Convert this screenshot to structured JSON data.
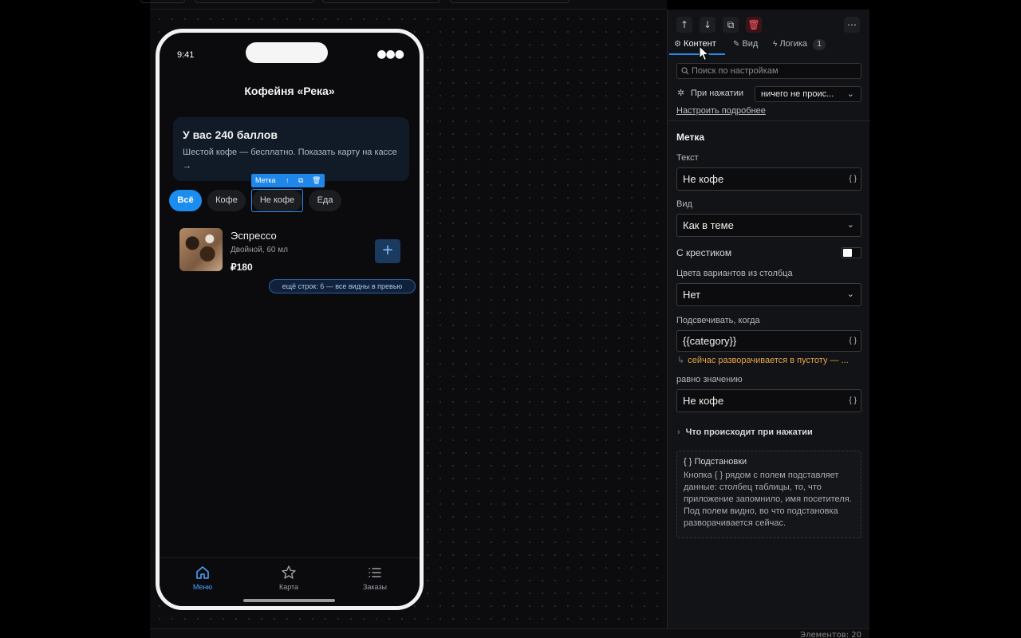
{
  "phone": {
    "time": "9:41",
    "signal": "●●●",
    "title": "Кофейня «Река»",
    "loyalty": {
      "title": "У вас 240 баллов",
      "subtitle": "Шестой кофе — бесплатно. Показать карту на кассе →"
    },
    "chips": [
      "Всё",
      "Кофе",
      "Не кофе",
      "Еда"
    ],
    "selection_tag": "Метка",
    "item": {
      "name": "Эспрессо",
      "desc": "Двойной, 60 мл",
      "price": "₽180",
      "add": "+"
    },
    "more_rows": "ещё строк: 6 — все видны в превью",
    "tabs": [
      {
        "label": "Меню",
        "icon": "home-icon"
      },
      {
        "label": "Карта",
        "icon": "star-icon"
      },
      {
        "label": "Заказы",
        "icon": "list-icon"
      }
    ]
  },
  "panel": {
    "toolbar": {
      "move_up": "↑",
      "move_down": "↓",
      "duplicate": "⧉",
      "delete": "🗑",
      "more": "⋯"
    },
    "tabs": {
      "content": "Контент",
      "view": "Вид",
      "logic": "Логика",
      "logic_badge": "1"
    },
    "search_placeholder": "Поиск по настройкам",
    "on_press_label": "При нажатии",
    "on_press_value": "ничего не проис...",
    "configure_link": "Настроить подробнее",
    "section_title": "Метка",
    "text_label": "Текст",
    "text_value": "Не кофе",
    "view_label": "Вид",
    "view_value": "Как в теме",
    "close_label": "С крестиком",
    "colors_label": "Цвета вариантов из столбца",
    "colors_value": "Нет",
    "highlight_label": "Подсвечивать, когда",
    "highlight_value": "{{category}}",
    "highlight_warning": "сейчас разворачивается в пустоту — ...",
    "equals_label": "равно значению",
    "equals_value": "Не кофе",
    "expander": "Что происходит при нажатии",
    "hint_title": "{ } Подстановки",
    "hint_body": "Кнопка { } рядом с полем подставляет данные: столбец таблицы, то, что приложение запомнило, имя посетителя. Под полем видно, во что подстановка разворачивается сейчас.",
    "braces": "{ }"
  },
  "footer": {
    "element_count": "Элементов: 20"
  },
  "colors": {
    "accent": "#1c8df0",
    "warning": "#e6a44a",
    "danger": "#ff5a64"
  }
}
